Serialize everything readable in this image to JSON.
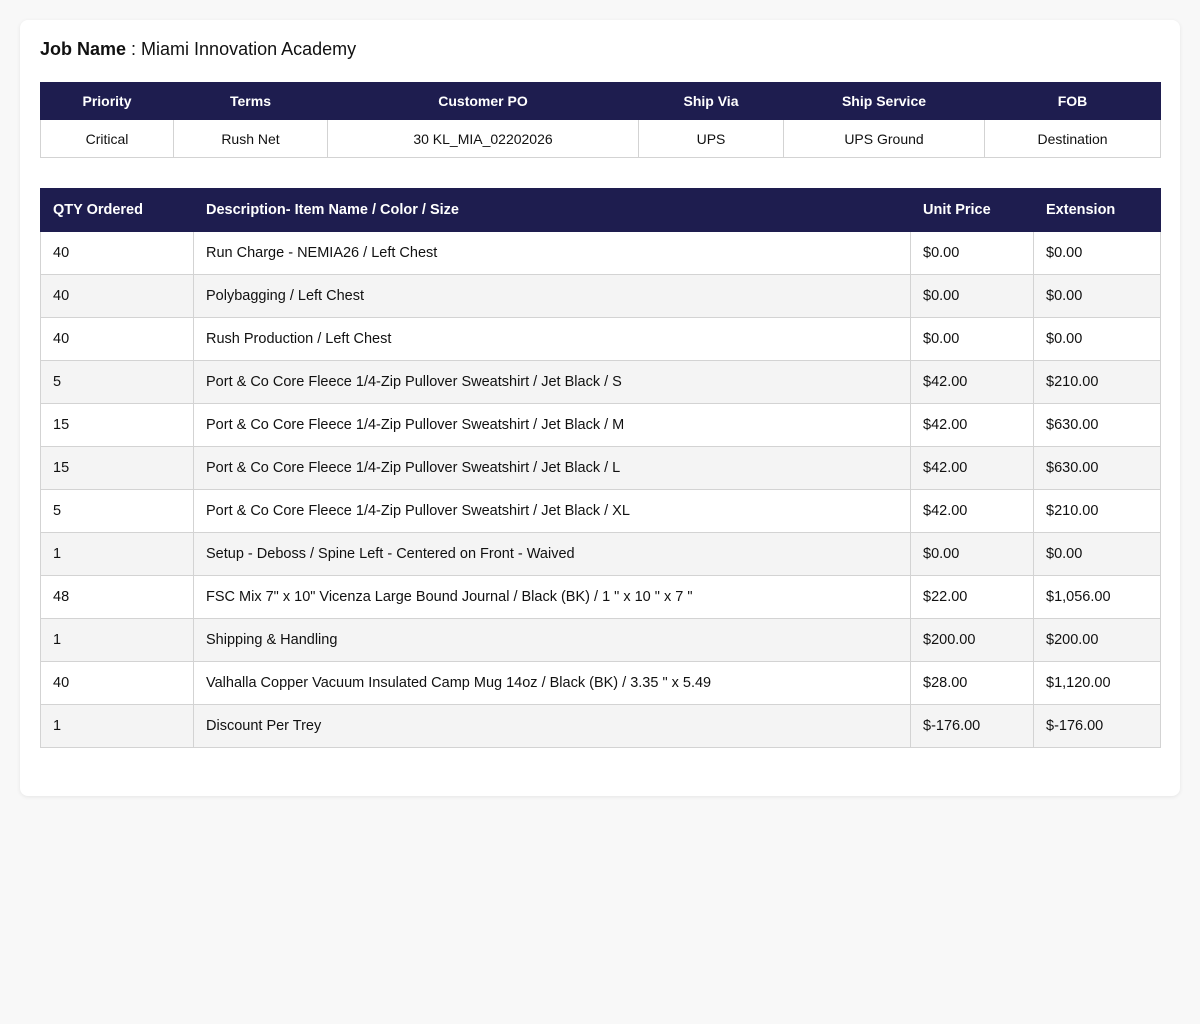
{
  "job": {
    "label": "Job Name",
    "separator": " : ",
    "value": "Miami Innovation Academy"
  },
  "order_info": {
    "headers": [
      "Priority",
      "Terms",
      "Customer PO",
      "Ship Via",
      "Ship Service",
      "FOB"
    ],
    "values": [
      "Critical",
      "Rush Net",
      "30 KL_MIA_02202026",
      "UPS",
      "UPS Ground",
      "Destination"
    ]
  },
  "items": {
    "headers": [
      "QTY Ordered",
      "Description- Item Name / Color / Size",
      "Unit Price",
      "Extension"
    ],
    "rows": [
      [
        "40",
        "Run Charge - NEMIA26 / Left Chest",
        "$0.00",
        "$0.00"
      ],
      [
        "40",
        "Polybagging / Left Chest",
        "$0.00",
        "$0.00"
      ],
      [
        "40",
        "Rush Production / Left Chest",
        "$0.00",
        "$0.00"
      ],
      [
        "5",
        "Port & Co Core Fleece 1/4-Zip Pullover Sweatshirt / Jet Black / S",
        "$42.00",
        "$210.00"
      ],
      [
        "15",
        "Port & Co Core Fleece 1/4-Zip Pullover Sweatshirt / Jet Black / M",
        "$42.00",
        "$630.00"
      ],
      [
        "15",
        "Port & Co Core Fleece 1/4-Zip Pullover Sweatshirt / Jet Black / L",
        "$42.00",
        "$630.00"
      ],
      [
        "5",
        "Port & Co Core Fleece 1/4-Zip Pullover Sweatshirt / Jet Black / XL",
        "$42.00",
        "$210.00"
      ],
      [
        "1",
        "Setup - Deboss / Spine Left - Centered on Front - Waived",
        "$0.00",
        "$0.00"
      ],
      [
        "48",
        "FSC Mix 7\" x 10\" Vicenza Large Bound Journal / Black (BK) / 1 \" x 10 \" x 7 \"",
        "$22.00",
        "$1,056.00"
      ],
      [
        "1",
        "Shipping & Handling",
        "$200.00",
        "$200.00"
      ],
      [
        "40",
        "Valhalla Copper Vacuum Insulated Camp Mug 14oz / Black (BK) / 3.35 \" x 5.49",
        "$28.00",
        "$1,120.00"
      ],
      [
        "1",
        "Discount Per Trey",
        "$-176.00",
        "$-176.00"
      ]
    ]
  },
  "colors": {
    "header_bg": "#1e1d4f",
    "row_alt_bg": "#f4f4f4",
    "border": "#d3d3d3"
  }
}
